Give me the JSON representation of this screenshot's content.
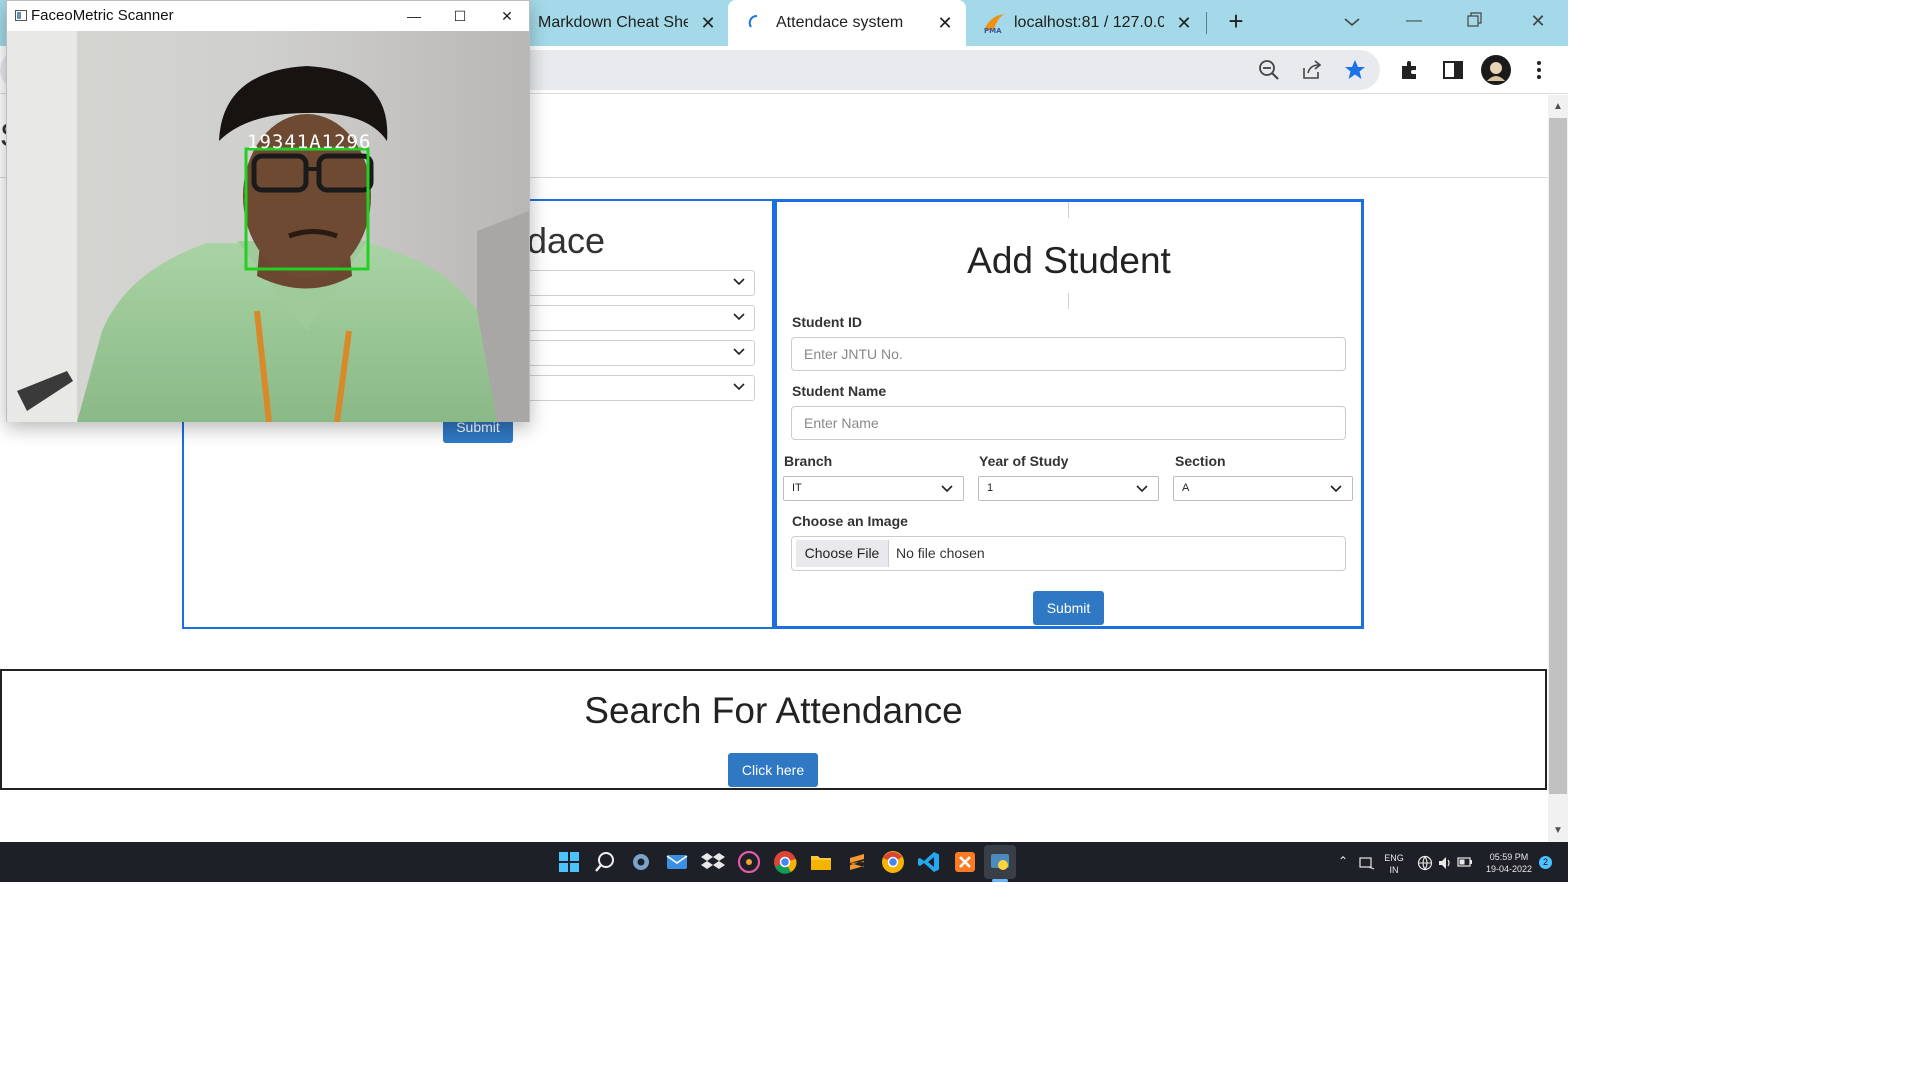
{
  "browser": {
    "tabs": [
      {
        "title": "Markdown Cheat She",
        "active": false
      },
      {
        "title": "Attendace system",
        "active": true
      },
      {
        "title": "localhost:81 / 127.0.0",
        "active": false
      }
    ],
    "colors": {
      "tabstrip": "#a3d9e8",
      "accent": "#1b6fe0",
      "button": "#2f78c4"
    }
  },
  "page": {
    "header_stub": "S",
    "attendance_panel": {
      "heading": "dace",
      "submit_label": "Submit"
    },
    "add_student": {
      "title": "Add Student",
      "student_id_label": "Student ID",
      "student_id_placeholder": "Enter JNTU No.",
      "student_name_label": "Student Name",
      "student_name_placeholder": "Enter Name",
      "branch_label": "Branch",
      "branch_value": "IT",
      "year_label": "Year of Study",
      "year_value": "1",
      "section_label": "Section",
      "section_value": "A",
      "image_label": "Choose an Image",
      "file_button": "Choose File",
      "file_status": "No file chosen",
      "submit_label": "Submit"
    },
    "search": {
      "title": "Search For Attendance",
      "button_label": "Click here"
    }
  },
  "scanner_window": {
    "title": "FaceoMetric Scanner",
    "detected_id": "19341A1296",
    "box_color": "#22d022"
  },
  "taskbar": {
    "language": "ENG",
    "region": "IN",
    "time": "05:59 PM",
    "date": "19-04-2022",
    "notification_count": "2"
  }
}
